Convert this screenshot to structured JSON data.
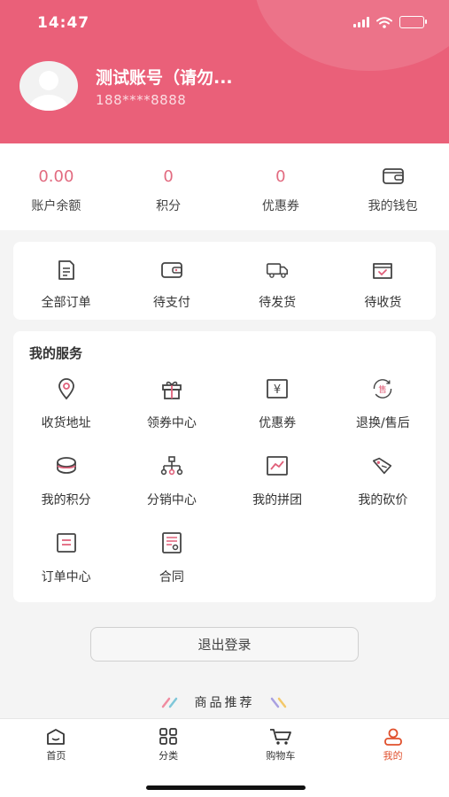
{
  "status_bar": {
    "time": "14:47"
  },
  "profile": {
    "name": "测试账号（请勿...",
    "phone": "188****8888"
  },
  "stats": [
    {
      "value": "0.00",
      "label": "账户余额"
    },
    {
      "value": "0",
      "label": "积分"
    },
    {
      "value": "0",
      "label": "优惠券"
    },
    {
      "icon": "wallet-icon",
      "label": "我的钱包"
    }
  ],
  "orders": [
    {
      "icon": "all-orders-icon",
      "label": "全部订单"
    },
    {
      "icon": "pending-payment-icon",
      "label": "待支付"
    },
    {
      "icon": "pending-shipment-icon",
      "label": "待发货"
    },
    {
      "icon": "pending-receipt-icon",
      "label": "待收货"
    }
  ],
  "services": {
    "title": "我的服务",
    "items": [
      {
        "icon": "location-icon",
        "label": "收货地址"
      },
      {
        "icon": "gift-icon",
        "label": "领券中心"
      },
      {
        "icon": "coupon-icon",
        "label": "优惠券"
      },
      {
        "icon": "after-sales-icon",
        "label": "退换/售后",
        "glyph": "售"
      },
      {
        "icon": "points-icon",
        "label": "我的积分"
      },
      {
        "icon": "distribution-icon",
        "label": "分销中心"
      },
      {
        "icon": "group-buy-icon",
        "label": "我的拼团"
      },
      {
        "icon": "bargain-icon",
        "label": "我的砍价"
      },
      {
        "icon": "order-center-icon",
        "label": "订单中心"
      },
      {
        "icon": "contract-icon",
        "label": "合同"
      }
    ]
  },
  "logout_label": "退出登录",
  "recommend_title": "商品推荐",
  "tabbar": [
    {
      "icon": "home-icon",
      "label": "首页"
    },
    {
      "icon": "category-icon",
      "label": "分类"
    },
    {
      "icon": "cart-icon",
      "label": "购物车"
    },
    {
      "icon": "profile-icon",
      "label": "我的",
      "active": true
    }
  ],
  "colors": {
    "brand": "#ea6079",
    "stat_value": "#e26b80",
    "icon_accent": "#e0607a",
    "tab_active": "#e0502d"
  }
}
